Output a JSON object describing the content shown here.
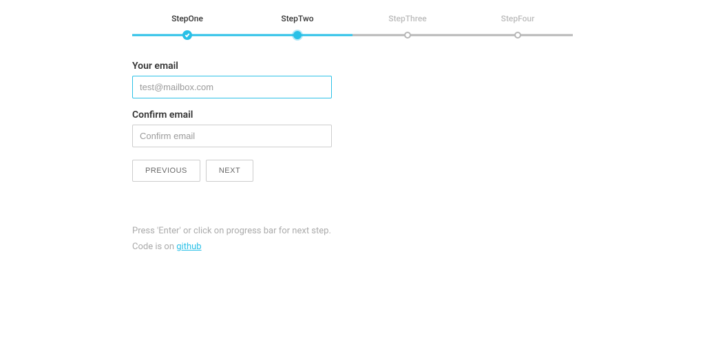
{
  "steps": [
    {
      "label": "StepOne",
      "state": "done"
    },
    {
      "label": "StepTwo",
      "state": "current"
    },
    {
      "label": "StepThree",
      "state": "inactive"
    },
    {
      "label": "StepFour",
      "state": "inactive"
    }
  ],
  "form": {
    "email_label": "Your email",
    "email_placeholder": "test@mailbox.com",
    "email_value": "",
    "confirm_label": "Confirm email",
    "confirm_placeholder": "Confirm email",
    "confirm_value": ""
  },
  "buttons": {
    "previous": "Previous",
    "next": "Next"
  },
  "help": {
    "hint": "Press 'Enter' or click on progress bar for next step.",
    "code_prefix": "Code is on ",
    "code_link_text": "github"
  }
}
